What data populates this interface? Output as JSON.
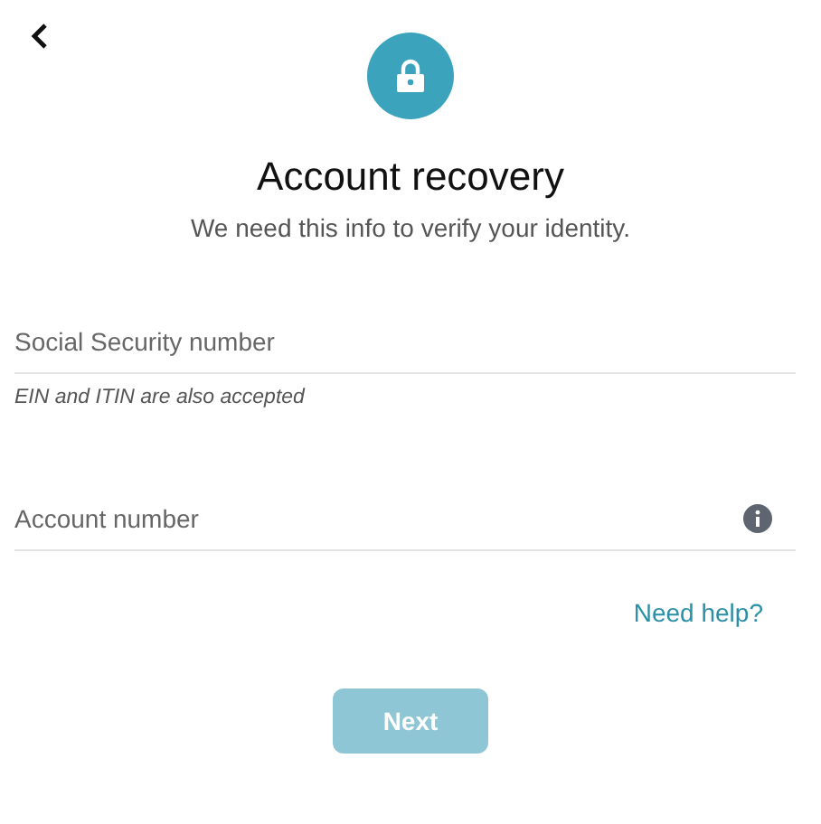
{
  "header": {
    "title": "Account recovery",
    "subtitle": "We need this info to verify your identity."
  },
  "fields": [
    {
      "placeholder": "Social Security number",
      "hint": "EIN and ITIN are also accepted",
      "info": false
    },
    {
      "placeholder": "Account number",
      "info": true
    }
  ],
  "help_link": "Need help?",
  "next_button": {
    "label": "Next",
    "disabled": true
  }
}
